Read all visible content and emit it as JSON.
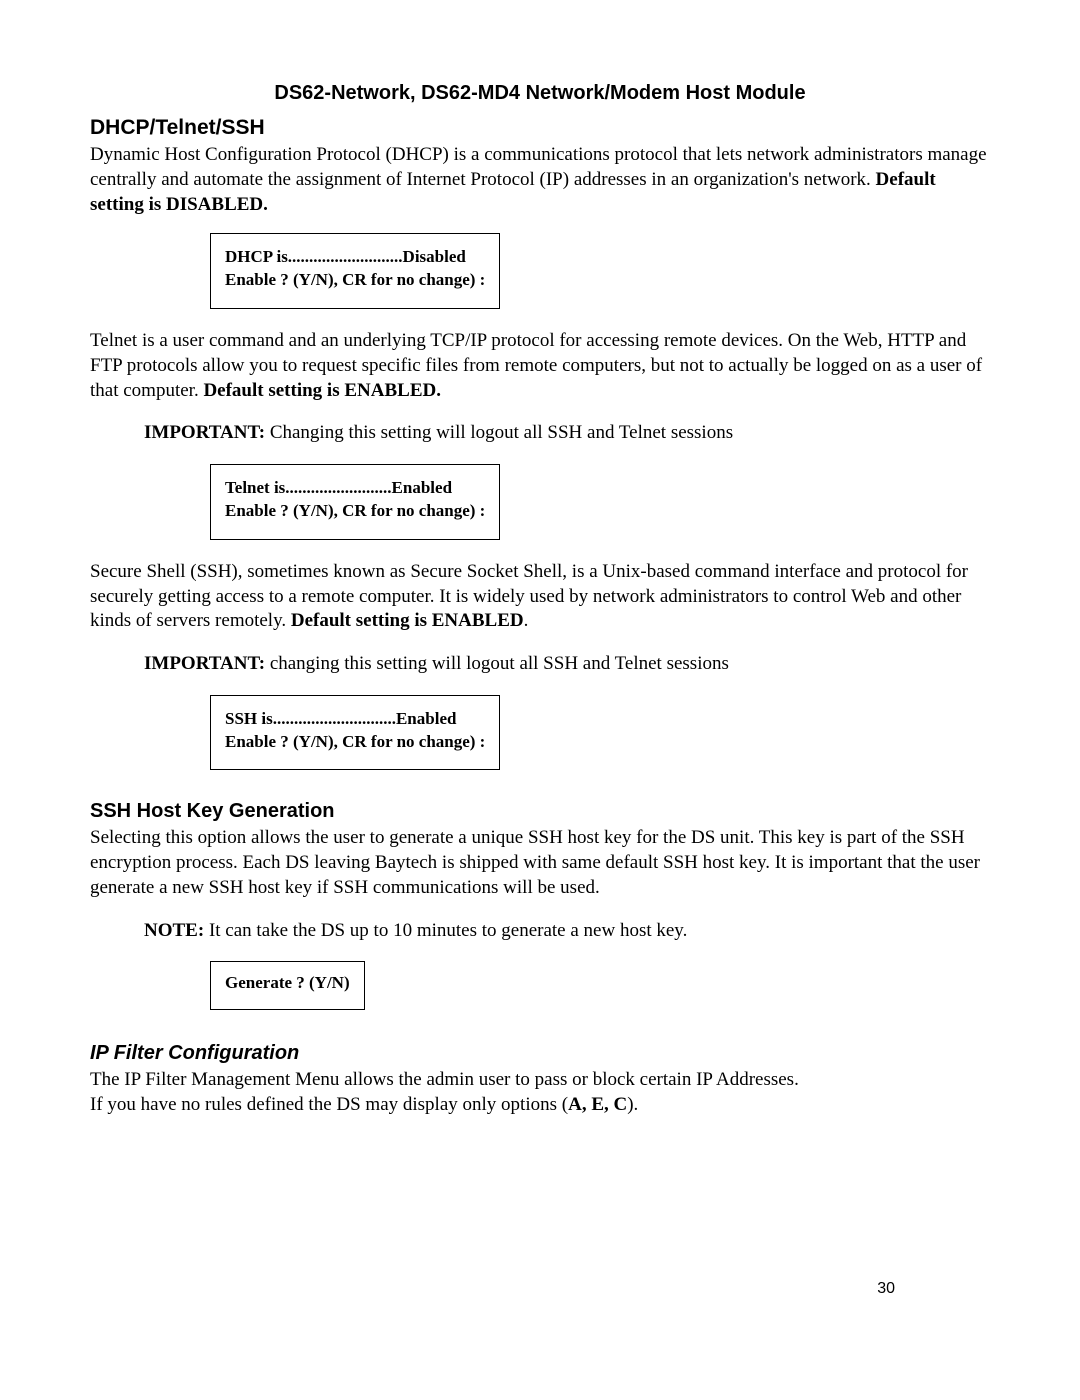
{
  "header": "DS62-Network, DS62-MD4 Network/Modem Host Module",
  "dhcp": {
    "heading": "DHCP/Telnet/SSH",
    "para_pre": "Dynamic Host Configuration Protocol (DHCP) is a communications protocol that lets network administrators manage centrally and automate the assignment of Internet Protocol (IP) addresses in an organization's network. ",
    "para_bold": "Default setting is DISABLED.",
    "box": "DHCP is...........................Disabled\nEnable ? (Y/N), CR for no change) :"
  },
  "telnet": {
    "para_pre": "Telnet is a user command and an underlying TCP/IP protocol for accessing remote devices. On the Web, HTTP and FTP protocols allow you to request specific files from remote computers, but not to actually be logged on as a user of that computer. ",
    "para_bold": "Default setting is ENABLED.",
    "important_label": "IMPORTANT:",
    "important_text": " Changing this setting will logout all SSH and Telnet sessions",
    "box": "Telnet is.........................Enabled\nEnable ? (Y/N), CR for no change) :"
  },
  "ssh": {
    "para_pre": "Secure Shell (SSH), sometimes known as Secure Socket Shell, is a Unix-based command interface and protocol for securely getting access to a remote computer. It is widely used by network administrators to control Web and other kinds of servers remotely. ",
    "para_bold": "Default setting is ENABLED",
    "para_post": ".",
    "important_label": "IMPORTANT:",
    "important_text": " changing this setting will logout all SSH and Telnet sessions",
    "box": "SSH is.............................Enabled\nEnable ? (Y/N), CR for no change) :"
  },
  "hostkey": {
    "heading": "SSH Host Key Generation",
    "para": "Selecting this option allows the user to generate a unique SSH host key for the DS unit. This key is part of the SSH encryption process. Each DS leaving Baytech is shipped with same default SSH host key. It is important that the user generate a new SSH host key if SSH communications will be used.",
    "note_label": "NOTE:",
    "note_text": " It can take the DS up to 10 minutes to generate a new host key.",
    "box": "Generate ? (Y/N)"
  },
  "ipfilter": {
    "heading": "IP Filter Configuration",
    "line1": "The IP Filter Management Menu allows the admin user to pass or block certain IP Addresses.",
    "line2_pre": "If you have no rules defined the DS may display only options (",
    "line2_bold": "A, E, C",
    "line2_post": ")."
  },
  "page_number": "30"
}
